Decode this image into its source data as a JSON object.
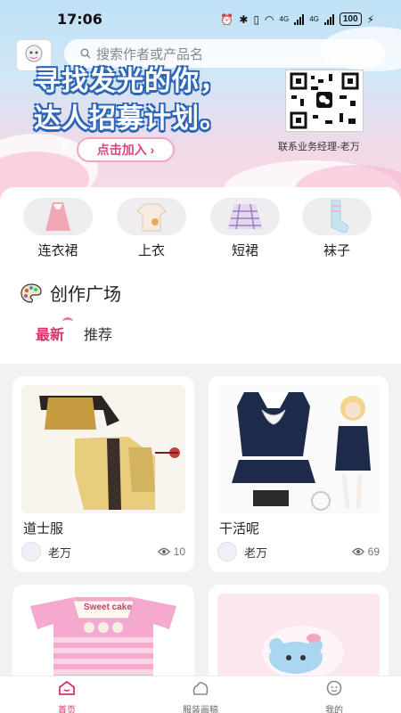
{
  "status": {
    "time": "17:06",
    "battery": "100",
    "net1": "4G",
    "net2": "4G"
  },
  "search": {
    "placeholder": "搜索作者或产品名"
  },
  "banner": {
    "line1": "寻找发光的你，",
    "line2": "达人招募计划。",
    "join_button": "点击加入 ›",
    "contact": "联系业务经理-老万"
  },
  "categories": [
    {
      "label": "连衣裙",
      "icon": "dress-icon"
    },
    {
      "label": "上衣",
      "icon": "top-icon"
    },
    {
      "label": "短裙",
      "icon": "skirt-icon"
    },
    {
      "label": "袜子",
      "icon": "sock-icon"
    }
  ],
  "section": {
    "title": "创作广场",
    "icon": "palette-icon"
  },
  "tabs": [
    {
      "label": "最新",
      "active": true
    },
    {
      "label": "推荐",
      "active": false
    }
  ],
  "cards": [
    {
      "title": "道士服",
      "author": "老万",
      "views": "10"
    },
    {
      "title": "干活呢",
      "author": "老万",
      "views": "69"
    },
    {
      "title": "",
      "author": "",
      "views": ""
    },
    {
      "title": "",
      "author": "",
      "views": ""
    }
  ],
  "card_images": {
    "card3_text": "Sweet cake"
  },
  "nav": [
    {
      "label": "首页",
      "icon": "home-icon",
      "active": true
    },
    {
      "label": "服装画稿",
      "icon": "design-icon",
      "active": false
    },
    {
      "label": "我的",
      "icon": "profile-icon",
      "active": false
    }
  ],
  "colors": {
    "accent": "#d6336c",
    "headline_stroke": "#2d66b8"
  }
}
